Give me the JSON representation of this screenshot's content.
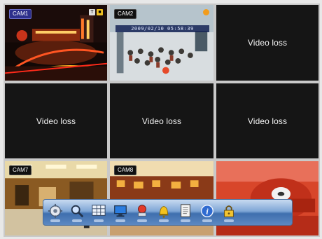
{
  "cameras": [
    {
      "label": "CAM1",
      "type": "live"
    },
    {
      "label": "CAM2",
      "type": "live",
      "timestamp": "2009/02/10 05:58:39"
    },
    {
      "label": "",
      "type": "loss",
      "message": "Video loss"
    },
    {
      "label": "",
      "type": "loss",
      "message": "Video loss"
    },
    {
      "label": "",
      "type": "loss",
      "message": "Video loss"
    },
    {
      "label": "",
      "type": "loss",
      "message": "Video loss"
    },
    {
      "label": "CAM7",
      "type": "live"
    },
    {
      "label": "CAM8",
      "type": "live"
    },
    {
      "label": "",
      "type": "live"
    }
  ],
  "toolbar": {
    "buttons": [
      {
        "icon": "gear-icon"
      },
      {
        "icon": "search-icon"
      },
      {
        "icon": "layout-grid-icon"
      },
      {
        "icon": "monitor-icon"
      },
      {
        "icon": "record-icon"
      },
      {
        "icon": "alarm-bell-icon"
      },
      {
        "icon": "log-document-icon"
      },
      {
        "icon": "info-icon"
      },
      {
        "icon": "lock-icon"
      }
    ]
  },
  "colors": {
    "toolbar_top": "#c8daf0",
    "toolbar_bottom": "#3f6fae",
    "video_loss_bg": "#151515",
    "video_loss_text": "#f4f4f4"
  }
}
